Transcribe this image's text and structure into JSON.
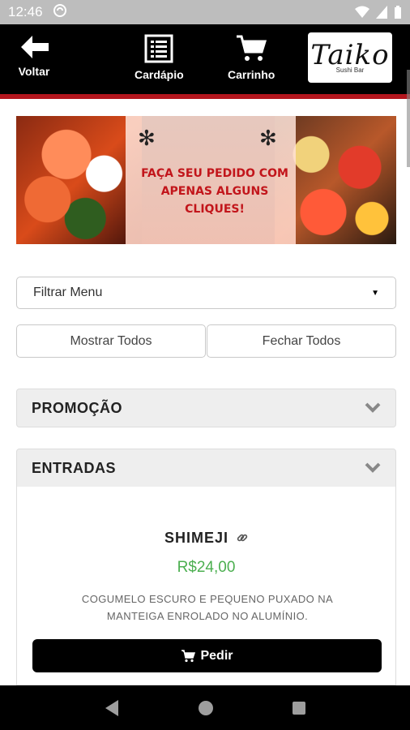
{
  "status": {
    "time": "12:46"
  },
  "header": {
    "back_label": "Voltar",
    "menu_label": "Cardápio",
    "cart_label": "Carrinho",
    "logo_text": "Taiko",
    "logo_sub": "Sushi Bar"
  },
  "banner": {
    "headline_1": "Faça seu pedido com",
    "headline_2": "apenas alguns cliques!"
  },
  "filter": {
    "selected": "Filtrar Menu"
  },
  "buttons": {
    "show_all": "Mostrar Todos",
    "close_all": "Fechar Todos"
  },
  "sections": [
    {
      "title": "PROMOÇÃO"
    },
    {
      "title": "ENTRADAS"
    }
  ],
  "item": {
    "name": "SHIMEJI",
    "price": "R$24,00",
    "description": "COGUMELO ESCURO E PEQUENO PUXADO NA MANTEIGA ENROLADO NO ALUMÍNIO.",
    "order_label": "Pedir"
  },
  "colors": {
    "accent_red": "#b3151d",
    "price_green": "#4caf50"
  },
  "icons": [
    "back-arrow-icon",
    "list-icon",
    "cart-icon",
    "chevron-down-icon",
    "link-icon",
    "cart-small-icon"
  ]
}
